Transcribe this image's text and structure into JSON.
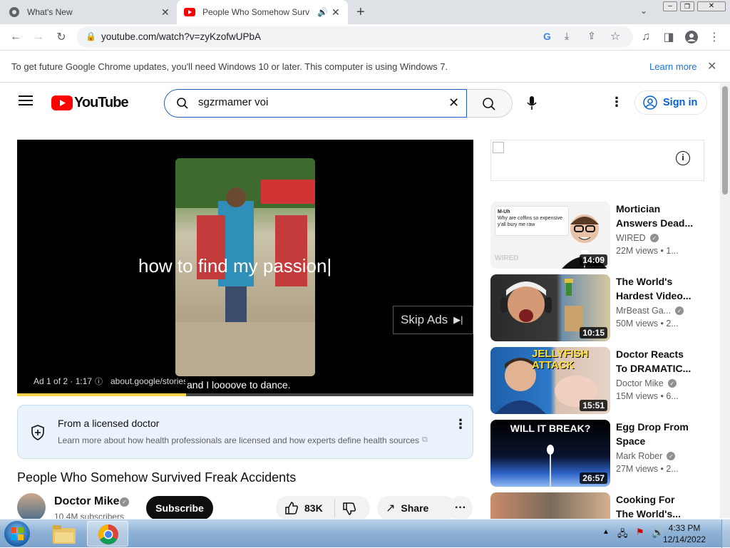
{
  "browser": {
    "tabs": [
      {
        "title": "What's New",
        "active": false
      },
      {
        "title": "People Who Somehow Survi",
        "active": true
      }
    ],
    "url": "youtube.com/watch?v=zyKzofwUPbA",
    "infobar": {
      "text": "To get future Google Chrome updates, you'll need Windows 10 or later. This computer is using Windows 7.",
      "learn_more": "Learn more"
    }
  },
  "youtube": {
    "logo_text": "YouTube",
    "search_value": "sgzrmamer voi",
    "signin_label": "Sign in"
  },
  "player": {
    "caption_main": "how to find my passion|",
    "caption_sub": "and I loooove to dance.",
    "skip_label": "Skip Ads",
    "ad_info": "Ad 1 of 2 · 1:17",
    "ad_url": "about.google/stories",
    "progress_fraction": 0.37
  },
  "licensed_panel": {
    "title": "From a licensed doctor",
    "text": "Learn more about how health professionals are licensed and how experts define health sources"
  },
  "video": {
    "title": "People Who Somehow Survived Freak Accidents",
    "channel": "Doctor Mike",
    "subscribers": "10.4M subscribers",
    "subscribe_label": "Subscribe",
    "likes": "83K",
    "share_label": "Share"
  },
  "recommendations": [
    {
      "title": "Mortician Answers Dead...",
      "channel": "WIRED",
      "views": "22M views • 1...",
      "duration": "14:09",
      "thumb_text": "WIRED"
    },
    {
      "title": "The World's Hardest Video...",
      "channel": "MrBeast Ga...",
      "views": "50M views • 2...",
      "duration": "10:15",
      "thumb_text": ""
    },
    {
      "title": "Doctor Reacts To DRAMATIC...",
      "channel": "Doctor Mike",
      "views": "15M views • 6...",
      "duration": "15:51",
      "thumb_text": "JELLYFISH ATTACK"
    },
    {
      "title": "Egg Drop From Space",
      "channel": "Mark Rober",
      "views": "27M views • 2...",
      "duration": "26:57",
      "thumb_text": "WILL IT BREAK?"
    },
    {
      "title": "Cooking For The World's...",
      "channel": "",
      "views": "",
      "duration": "",
      "thumb_text": ""
    }
  ],
  "thumb_snippet": {
    "user": "M-Uh",
    "text": "Why are coffins so expensive y'all bury me raw"
  },
  "taskbar": {
    "time": "4:33 PM",
    "date": "12/14/2022"
  },
  "colors": {
    "youtube_red": "#ff0000",
    "link_blue": "#065fd4",
    "chrome_link": "#1a73e8"
  }
}
